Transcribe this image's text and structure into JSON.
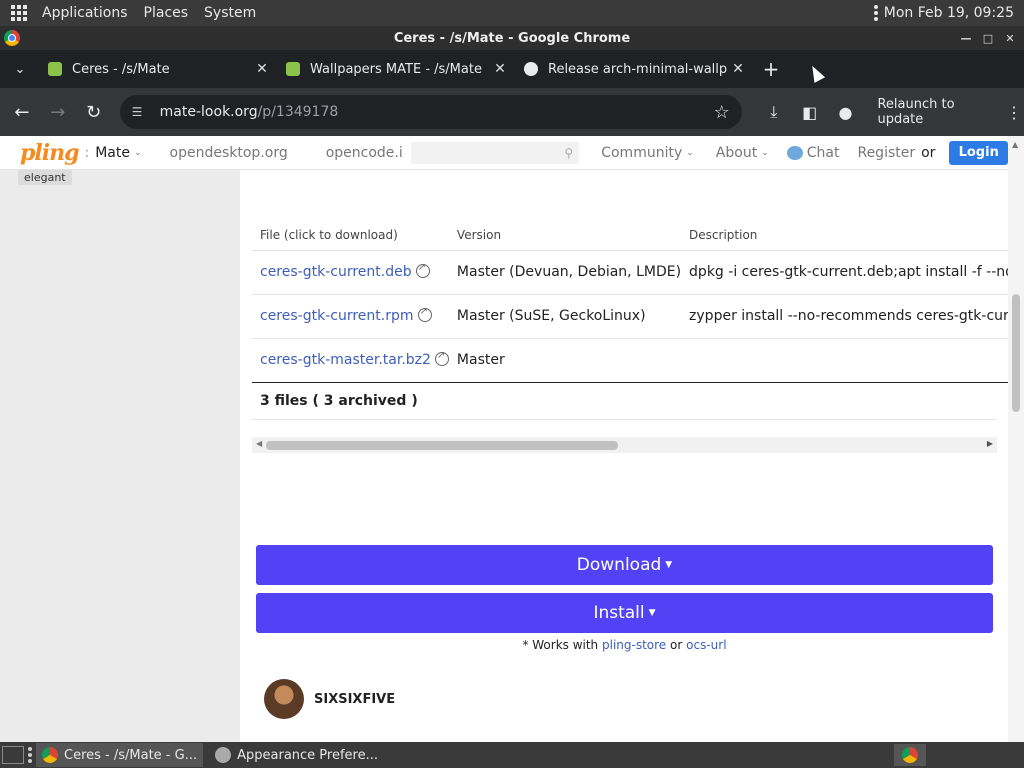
{
  "top_panel": {
    "menus": [
      "Applications",
      "Places",
      "System"
    ],
    "clock": "Mon Feb 19, 09:25"
  },
  "window": {
    "title": "Ceres - /s/Mate - Google Chrome"
  },
  "tabs": [
    {
      "label": "Ceres - /s/Mate",
      "icon": "pling-favicon"
    },
    {
      "label": "Wallpapers MATE - /s/Mate",
      "icon": "pling-favicon"
    },
    {
      "label": "Release arch-minimal-wallp",
      "icon": "github-icon"
    }
  ],
  "toolbar": {
    "url_host": "mate-look.org",
    "url_path": "/p/1349178",
    "relaunch_label": "Relaunch to update"
  },
  "site_header": {
    "logo": "pling",
    "store": "Mate",
    "links": [
      "opendesktop.org",
      "opencode.i"
    ],
    "nav": [
      "Community",
      "About"
    ],
    "chat": "Chat",
    "register": "Register",
    "or": "or",
    "login": "Login"
  },
  "left_col": {
    "tag": "elegant"
  },
  "files": {
    "headers": [
      "File (click to download)",
      "Version",
      "Description"
    ],
    "rows": [
      {
        "file": "ceres-gtk-current.deb",
        "version": "Master (Devuan, Debian, LMDE)",
        "description": "dpkg -i ceres-gtk-current.deb;apt install -f --no-ins"
      },
      {
        "file": "ceres-gtk-current.rpm",
        "version": "Master (SuSE, GeckoLinux)",
        "description": "zypper install --no-recommends ceres-gtk-current"
      },
      {
        "file": "ceres-gtk-master.tar.bz2",
        "version": "Master",
        "description": ""
      }
    ],
    "summary": "3 files ( 3 archived )"
  },
  "actions": {
    "download": "Download",
    "install": "Install",
    "works_prefix": "* Works with",
    "works_link1": "pling-store",
    "works_or": "or",
    "works_link2": "ocs-url"
  },
  "author": {
    "name": "SIXSIXFIVE"
  },
  "taskbar": {
    "tasks": [
      "Ceres - /s/Mate - G...",
      "Appearance Prefere..."
    ]
  }
}
